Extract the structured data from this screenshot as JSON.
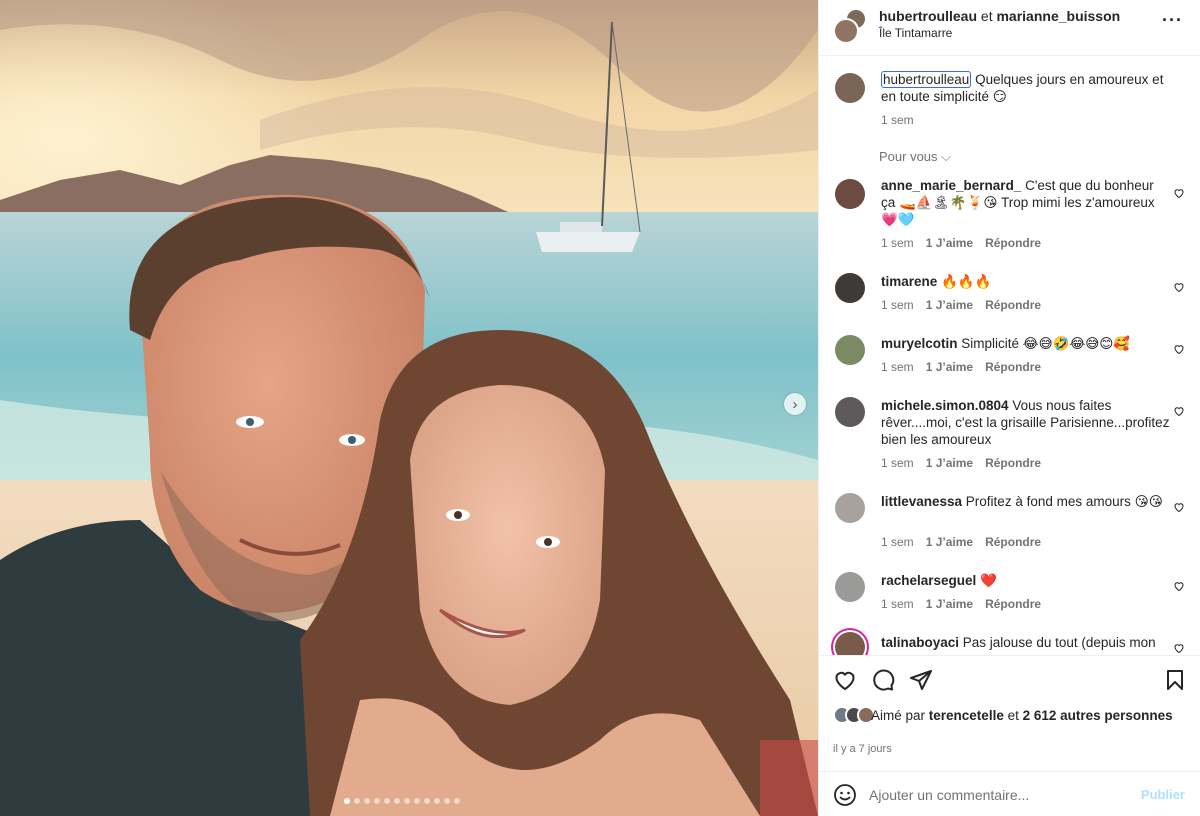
{
  "post": {
    "author_line_user1": "hubertroulleau",
    "author_line_sep": " et ",
    "author_line_user2": "marianne_buisson",
    "location": "Île Tintamarre",
    "more_icon": "more-horizontal-icon",
    "carousel": {
      "slides": 12,
      "active_index": 0,
      "next_icon": "chevron-right-icon"
    }
  },
  "caption": {
    "user": "hubertroulleau",
    "text": " Quelques jours en amoureux et en toute simplicité 😏",
    "time": "1 sem"
  },
  "pour_vous": "Pour vous ⌵",
  "comments": [
    {
      "user": "anne_marie_bernard_",
      "text": " C'est que du bonheur ça 🚤⛵🏝🌴🍹😘 Trop mimi les z'amoureux 💗🩵",
      "time": "1 sem",
      "likes": "1 J’aime",
      "reply": "Répondre"
    },
    {
      "user": "timarene",
      "text": " 🔥🔥🔥",
      "time": "1 sem",
      "likes": "1 J’aime",
      "reply": "Répondre"
    },
    {
      "user": "muryelcotin",
      "text": " Simplicité 😂😅🤣😂😅😊🥰",
      "time": "1 sem",
      "likes": "1 J’aime",
      "reply": "Répondre"
    },
    {
      "user": "michele.simon.0804",
      "text": " Vous nous faites rêver....moi, c'est la grisaille Parisienne...profitez bien les amoureux",
      "time": "1 sem",
      "likes": "1 J’aime",
      "reply": "Répondre"
    },
    {
      "user": "littlevanessa",
      "text": " Profitez à fond mes amours 😘😘",
      "time": "1 sem",
      "likes": "1 J’aime",
      "reply": "Répondre"
    },
    {
      "user": "rachelarseguel",
      "text": " ❤️",
      "time": "1 sem",
      "likes": "1 J’aime",
      "reply": "Répondre"
    },
    {
      "user": "talinaboyaci",
      "text": " Pas jalouse du tout (depuis mon",
      "time": "",
      "likes": "",
      "reply": ""
    }
  ],
  "actions": {
    "like_icon": "heart-icon",
    "comment_icon": "comment-icon",
    "share_icon": "send-icon",
    "save_icon": "bookmark-icon"
  },
  "likes": {
    "prefix": "Aimé par ",
    "user": "terencetelle",
    "middle": " et ",
    "count": "2 612 autres personnes"
  },
  "date": "il y a 7 jours",
  "add_comment": {
    "emoji_icon": "smiley-icon",
    "placeholder": "Ajouter un commentaire...",
    "publish": "Publier"
  },
  "colors": {
    "link_blue": "#0095f6",
    "publish_disabled": "#b2dffc",
    "secondary_text": "#737373",
    "border": "#efefef",
    "heart_red": "#ed4956"
  }
}
